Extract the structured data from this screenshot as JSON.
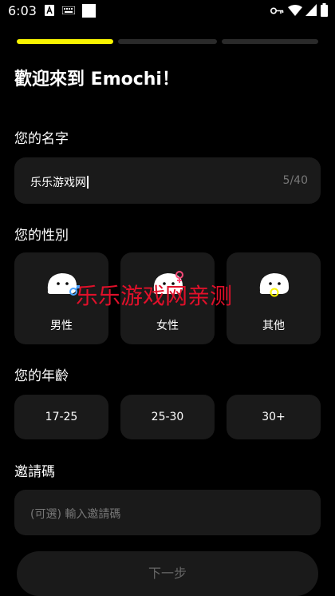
{
  "status_bar": {
    "time": "6:03"
  },
  "progress": {
    "current_step": 1,
    "total_steps": 3
  },
  "page": {
    "title": "歡迎來到 Emochi！"
  },
  "name": {
    "label": "您的名字",
    "value": "乐乐游戏网",
    "counter": "5/40"
  },
  "gender": {
    "label": "您的性別",
    "options": [
      {
        "label": "男性"
      },
      {
        "label": "女性"
      },
      {
        "label": "其他"
      }
    ]
  },
  "age": {
    "label": "您的年齡",
    "options": [
      "17-25",
      "25-30",
      "30+"
    ]
  },
  "invite": {
    "label": "邀請碼",
    "placeholder": "(可選) 輸入邀請碼"
  },
  "next_button": {
    "label": "下一步"
  },
  "watermark": {
    "text": "乐乐游戏网亲测"
  },
  "colors": {
    "accent": "#f8f400",
    "card": "#1a1a1a",
    "male_symbol": "#4aa3ff",
    "female_symbol": "#ff4a7a",
    "other_symbol": "#f8f400"
  }
}
